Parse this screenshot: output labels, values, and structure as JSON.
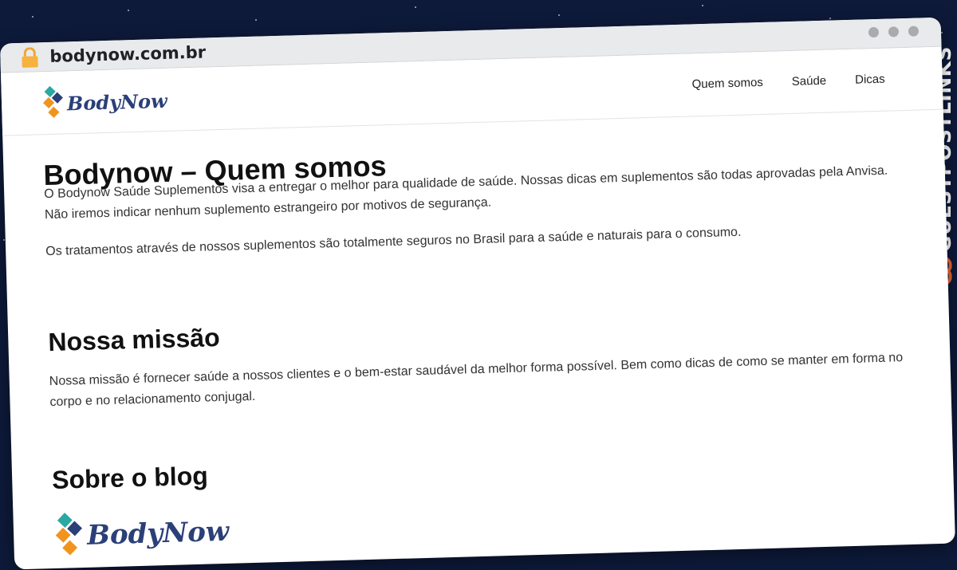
{
  "browser": {
    "url": "bodynow.com.br"
  },
  "site": {
    "logo_text": "BodyNow",
    "nav": [
      {
        "label": "Quem somos"
      },
      {
        "label": "Saúde"
      },
      {
        "label": "Dicas"
      }
    ]
  },
  "content": {
    "title": "Bodynow – Quem somos",
    "intro": "O Bodynow Saúde Suplementos visa a entregar o melhor para qualidade de saúde. Nossas dicas em suplementos são todas aprovadas pela Anvisa. Não iremos indicar nenhum suplemento estrangeiro por motivos de segurança.",
    "paragraph2": "Os tratamentos através de nossos suplementos são totalmente seguros no Brasil para a saúde e naturais para o consumo.",
    "mission_heading": "Nossa missão",
    "mission_text": "Nossa missão é fornecer saúde a nossos clientes e o bem-estar saudável da melhor forma possível. Bem como dicas de como se manter em forma no corpo e no relacionamento conjugal.",
    "blog_heading": "Sobre o blog",
    "blog_logo_text": "BodyNow"
  },
  "watermark": {
    "text": "GUESTPOSTLINKS"
  },
  "colors": {
    "background": "#0d1a3a",
    "logo_blue": "#2b3f78",
    "logo_orange": "#f0941f",
    "logo_teal": "#2aa9a2",
    "watermark_orange": "#f06a3a"
  }
}
